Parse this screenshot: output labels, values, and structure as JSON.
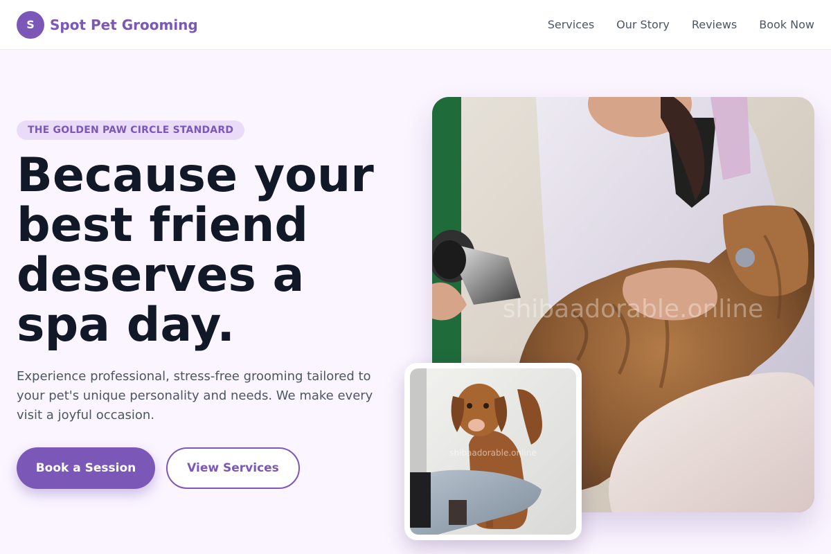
{
  "header": {
    "logo_letter": "S",
    "brand_name": "Spot Pet Grooming",
    "nav": [
      {
        "label": "Services"
      },
      {
        "label": "Our Story"
      },
      {
        "label": "Reviews"
      },
      {
        "label": "Book Now"
      }
    ]
  },
  "hero": {
    "badge": "THE GOLDEN PAW CIRCLE STANDARD",
    "headline": "Because your best friend deserves a spa day.",
    "subtext": "Experience professional, stress-free grooming tailored to your pet's unique personality and needs. We make every visit a joyful occasion.",
    "primary_button": "Book a Session",
    "secondary_button": "View Services",
    "main_image_watermark": "shibaadorable.online",
    "inset_image_watermark": "shibaadorable.online"
  },
  "colors": {
    "brand": "#7b57b8",
    "background": "#fbf5ff",
    "badge_bg": "#eadcf8",
    "headline": "#111827",
    "body_text": "#4b5563"
  }
}
